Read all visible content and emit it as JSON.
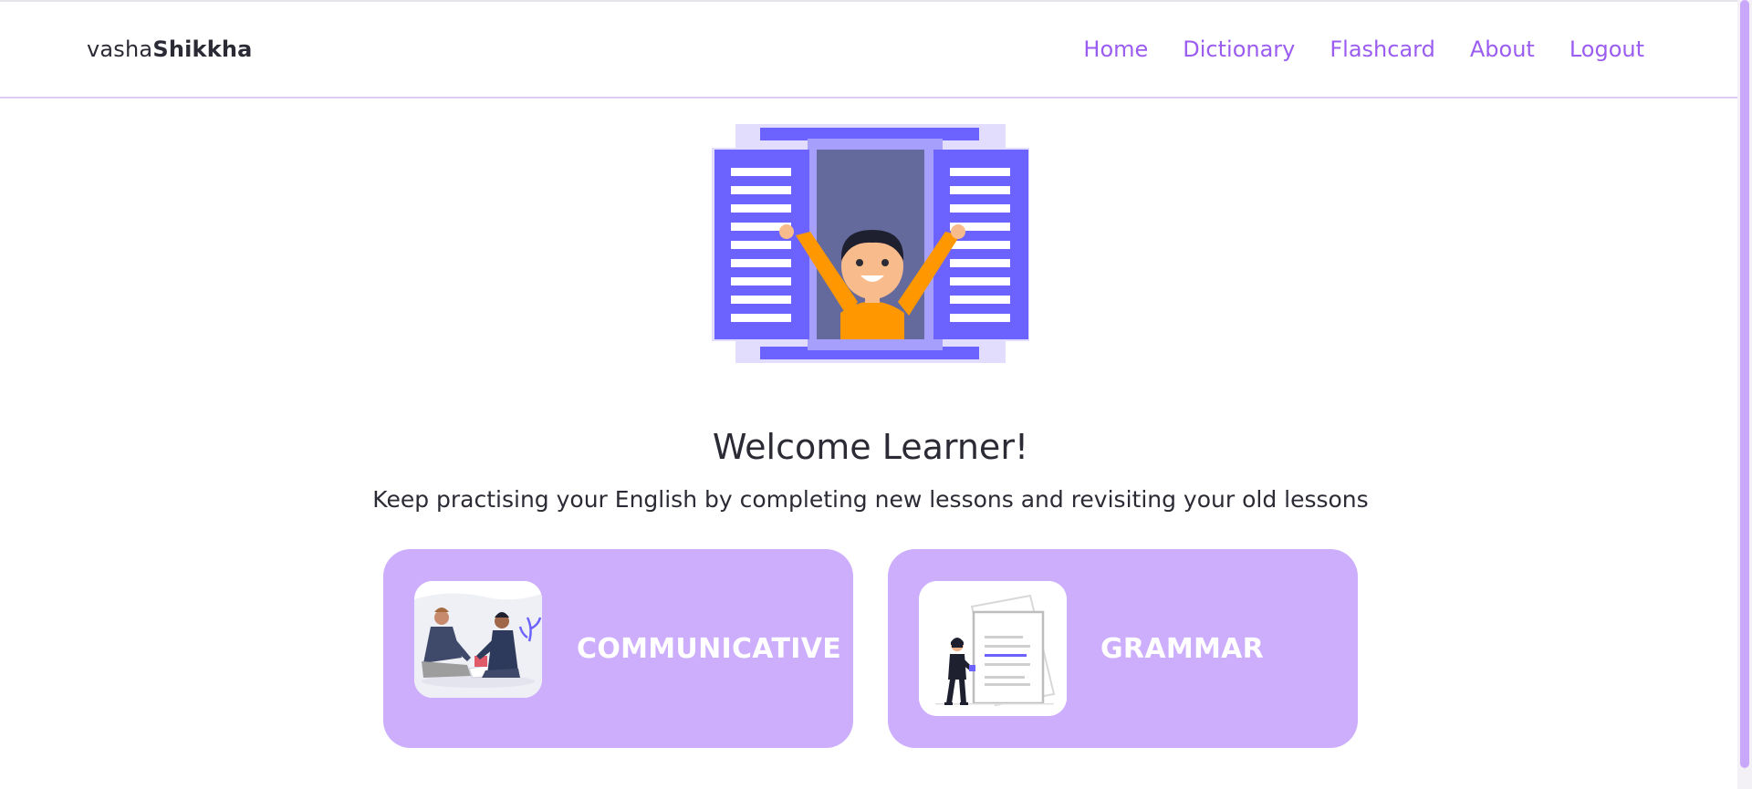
{
  "brand": {
    "part1": "vasha",
    "part2": "Shikkha"
  },
  "nav": {
    "items": [
      {
        "label": "Home"
      },
      {
        "label": "Dictionary"
      },
      {
        "label": "Flashcard"
      },
      {
        "label": "About"
      },
      {
        "label": "Logout"
      }
    ]
  },
  "hero": {
    "illustration": "child-at-window-illustration"
  },
  "main": {
    "title": "Welcome Learner!",
    "subtitle": "Keep practising your English by completing new lessons and revisiting your old lessons"
  },
  "cards": [
    {
      "label": "COMMUNICATIVE",
      "image": "two-people-talking-illustration"
    },
    {
      "label": "GRAMMAR",
      "image": "person-with-document-illustration"
    }
  ],
  "colors": {
    "accent": "#9b5cf0",
    "card_bg": "#ccaefc",
    "hero_purple": "#6c63ff",
    "hero_orange": "#ff9800"
  }
}
